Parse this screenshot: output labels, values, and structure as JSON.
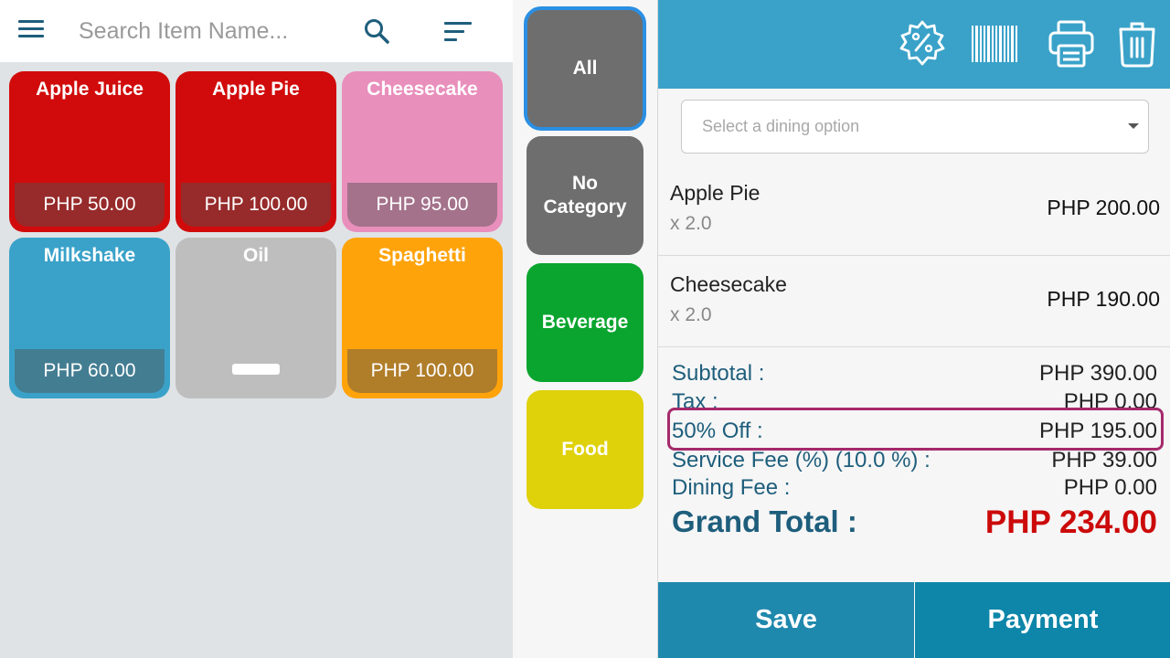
{
  "search": {
    "placeholder": "Search Item Name..."
  },
  "items": [
    {
      "name": "Apple Juice",
      "price": "PHP 50.00",
      "color": "#d10b0b"
    },
    {
      "name": "Apple Pie",
      "price": "PHP 100.00",
      "color": "#d10b0b"
    },
    {
      "name": "Cheesecake",
      "price": "PHP 95.00",
      "color": "#e98fbc"
    },
    {
      "name": "Milkshake",
      "price": "PHP 60.00",
      "color": "#3aa2c9"
    },
    {
      "name": "Oil",
      "price": "",
      "color": "#bebebe"
    },
    {
      "name": "Spaghetti",
      "price": "PHP 100.00",
      "color": "#ffa30a"
    }
  ],
  "categories": [
    {
      "label": "All",
      "color": "#6e6e6e",
      "selected": true
    },
    {
      "label": "No Category",
      "color": "#6e6e6e"
    },
    {
      "label": "Beverage",
      "color": "#0aa52f"
    },
    {
      "label": "Food",
      "color": "#dfd10a"
    }
  ],
  "dining": {
    "placeholder": "Select a dining option"
  },
  "order": [
    {
      "name": "Apple Pie",
      "qty": "x 2.0",
      "price": "PHP 200.00"
    },
    {
      "name": "Cheesecake",
      "qty": "x 2.0",
      "price": "PHP 190.00"
    }
  ],
  "summary": {
    "subtotal_label": "Subtotal :",
    "subtotal": "PHP 390.00",
    "tax_label": "Tax :",
    "tax": "PHP 0.00",
    "discount_label": "50% Off :",
    "discount": "PHP 195.00",
    "service_label": "Service Fee (%) (10.0 %) :",
    "service": "PHP 39.00",
    "dining_label": "Dining Fee :",
    "dining": "PHP 0.00",
    "grand_label": "Grand Total :",
    "grand": "PHP 234.00"
  },
  "buttons": {
    "save": "Save",
    "payment": "Payment"
  },
  "colors": {
    "header": "#3aa2c9",
    "accent": "#1e5e7c",
    "grand_total": "#cc0a0a",
    "highlight": "#a52a6c"
  }
}
